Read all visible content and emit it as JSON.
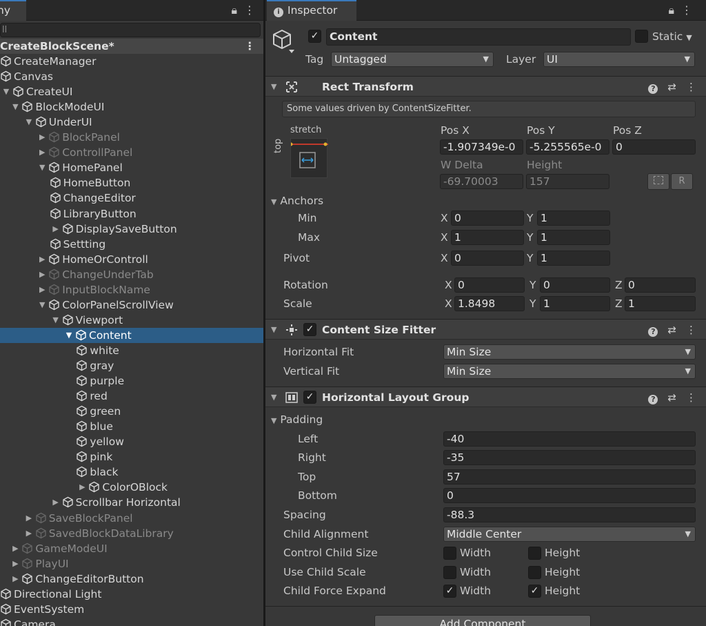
{
  "hierarchy": {
    "tab_label": "ny",
    "search_value": "ll",
    "scene_title": "CreateBlockScene*",
    "rows": [
      {
        "label": "CreateManager",
        "indent": 0,
        "arrow": "",
        "dim": false,
        "sel": false
      },
      {
        "label": "Canvas",
        "indent": 0,
        "arrow": "",
        "dim": false,
        "sel": false
      },
      {
        "label": "CreateUI",
        "indent": 0,
        "arrow": "▼",
        "dim": false,
        "sel": false
      },
      {
        "label": "BlockModeUI",
        "indent": 1,
        "arrow": "▼",
        "dim": false,
        "sel": false
      },
      {
        "label": "UnderUI",
        "indent": 2,
        "arrow": "▼",
        "dim": false,
        "sel": false
      },
      {
        "label": "BlockPanel",
        "indent": 3,
        "arrow": "▶",
        "dim": true,
        "sel": false
      },
      {
        "label": "ControllPanel",
        "indent": 3,
        "arrow": "▶",
        "dim": true,
        "sel": false
      },
      {
        "label": "HomePanel",
        "indent": 3,
        "arrow": "▼",
        "dim": false,
        "sel": false
      },
      {
        "label": "HomeButton",
        "indent": 4,
        "arrow": "",
        "dim": false,
        "sel": false
      },
      {
        "label": "ChangeEditor",
        "indent": 4,
        "arrow": "",
        "dim": false,
        "sel": false
      },
      {
        "label": "LibraryButton",
        "indent": 4,
        "arrow": "",
        "dim": false,
        "sel": false
      },
      {
        "label": "DisplaySaveButton",
        "indent": 4,
        "arrow": "▶",
        "dim": false,
        "sel": false
      },
      {
        "label": "Settting",
        "indent": 4,
        "arrow": "",
        "dim": false,
        "sel": false
      },
      {
        "label": "HomeOrControll",
        "indent": 3,
        "arrow": "▶",
        "dim": false,
        "sel": false
      },
      {
        "label": "ChangeUnderTab",
        "indent": 3,
        "arrow": "▶",
        "dim": true,
        "sel": false
      },
      {
        "label": "InputBlockName",
        "indent": 3,
        "arrow": "▶",
        "dim": true,
        "sel": false
      },
      {
        "label": "ColorPanelScrollView",
        "indent": 3,
        "arrow": "▼",
        "dim": false,
        "sel": false
      },
      {
        "label": "Viewport",
        "indent": 4,
        "arrow": "▼",
        "dim": false,
        "sel": false
      },
      {
        "label": "Content",
        "indent": 5,
        "arrow": "▼",
        "dim": false,
        "sel": true
      },
      {
        "label": "white",
        "indent": 6,
        "arrow": "",
        "dim": false,
        "sel": false
      },
      {
        "label": "gray",
        "indent": 6,
        "arrow": "",
        "dim": false,
        "sel": false
      },
      {
        "label": "purple",
        "indent": 6,
        "arrow": "",
        "dim": false,
        "sel": false
      },
      {
        "label": "red",
        "indent": 6,
        "arrow": "",
        "dim": false,
        "sel": false
      },
      {
        "label": "green",
        "indent": 6,
        "arrow": "",
        "dim": false,
        "sel": false
      },
      {
        "label": "blue",
        "indent": 6,
        "arrow": "",
        "dim": false,
        "sel": false
      },
      {
        "label": "yellow",
        "indent": 6,
        "arrow": "",
        "dim": false,
        "sel": false
      },
      {
        "label": "pink",
        "indent": 6,
        "arrow": "",
        "dim": false,
        "sel": false
      },
      {
        "label": "black",
        "indent": 6,
        "arrow": "",
        "dim": false,
        "sel": false
      },
      {
        "label": "ColorOBlock",
        "indent": 6,
        "arrow": "▶",
        "dim": false,
        "sel": false
      },
      {
        "label": "Scrollbar Horizontal",
        "indent": 4,
        "arrow": "▶",
        "dim": false,
        "sel": false
      },
      {
        "label": "SaveBlockPanel",
        "indent": 2,
        "arrow": "▶",
        "dim": true,
        "sel": false
      },
      {
        "label": "SavedBlockDataLibrary",
        "indent": 2,
        "arrow": "▶",
        "dim": true,
        "sel": false
      },
      {
        "label": "GameModeUI",
        "indent": 1,
        "arrow": "▶",
        "dim": true,
        "sel": false
      },
      {
        "label": "PlayUI",
        "indent": 1,
        "arrow": "▶",
        "dim": true,
        "sel": false
      },
      {
        "label": "ChangeEditorButton",
        "indent": 1,
        "arrow": "▶",
        "dim": false,
        "sel": false
      },
      {
        "label": "Directional Light",
        "indent": 0,
        "arrow": "",
        "dim": false,
        "sel": false
      },
      {
        "label": "EventSystem",
        "indent": 0,
        "arrow": "",
        "dim": false,
        "sel": false
      },
      {
        "label": "Camera",
        "indent": 0,
        "arrow": "",
        "dim": false,
        "sel": false
      }
    ]
  },
  "inspector": {
    "tab_label": "Inspector",
    "object_name": "Content",
    "static_label": "Static",
    "tag_label": "Tag",
    "tag_value": "Untagged",
    "layer_label": "Layer",
    "layer_value": "UI",
    "rect_transform": {
      "title": "Rect Transform",
      "note": "Some values driven by ContentSizeFitter.",
      "anchor_preset_top": "stretch",
      "anchor_preset_side": "top",
      "pos_x_label": "Pos X",
      "pos_y_label": "Pos Y",
      "pos_z_label": "Pos Z",
      "pos_x": "-1.907349e-0",
      "pos_y": "-5.255565e-0",
      "pos_z": "0",
      "w_delta_label": "W Delta",
      "height_label": "Height",
      "w_delta": "-69.70003",
      "height": "157",
      "raw_button": "R",
      "anchors_label": "Anchors",
      "min_label": "Min",
      "max_label": "Max",
      "pivot_label": "Pivot",
      "rotation_label": "Rotation",
      "scale_label": "Scale",
      "x": "X",
      "y": "Y",
      "z": "Z",
      "anchor_min_x": "0",
      "anchor_min_y": "1",
      "anchor_max_x": "1",
      "anchor_max_y": "1",
      "pivot_x": "0",
      "pivot_y": "1",
      "rotation_x": "0",
      "rotation_y": "0",
      "rotation_z": "0",
      "scale_x": "1.8498",
      "scale_y": "1",
      "scale_z": "1"
    },
    "content_size_fitter": {
      "title": "Content Size Fitter",
      "horizontal_fit_label": "Horizontal Fit",
      "horizontal_fit": "Min Size",
      "vertical_fit_label": "Vertical Fit",
      "vertical_fit": "Min Size"
    },
    "horizontal_layout_group": {
      "title": "Horizontal Layout Group",
      "padding_label": "Padding",
      "left_label": "Left",
      "left": "-40",
      "right_label": "Right",
      "right": "-35",
      "top_label": "Top",
      "top": "57",
      "bottom_label": "Bottom",
      "bottom": "0",
      "spacing_label": "Spacing",
      "spacing": "-88.3",
      "child_alignment_label": "Child Alignment",
      "child_alignment": "Middle Center",
      "control_child_size_label": "Control Child Size",
      "use_child_scale_label": "Use Child Scale",
      "child_force_expand_label": "Child Force Expand",
      "width_label": "Width",
      "height_label": "Height",
      "control_width": false,
      "control_height": false,
      "scale_width": false,
      "scale_height": false,
      "expand_width": true,
      "expand_height": true
    },
    "add_component": "Add Component"
  },
  "colors": {
    "selection": "#2c5d87",
    "panel": "#383838",
    "accent_tab": "#3a79bb"
  }
}
